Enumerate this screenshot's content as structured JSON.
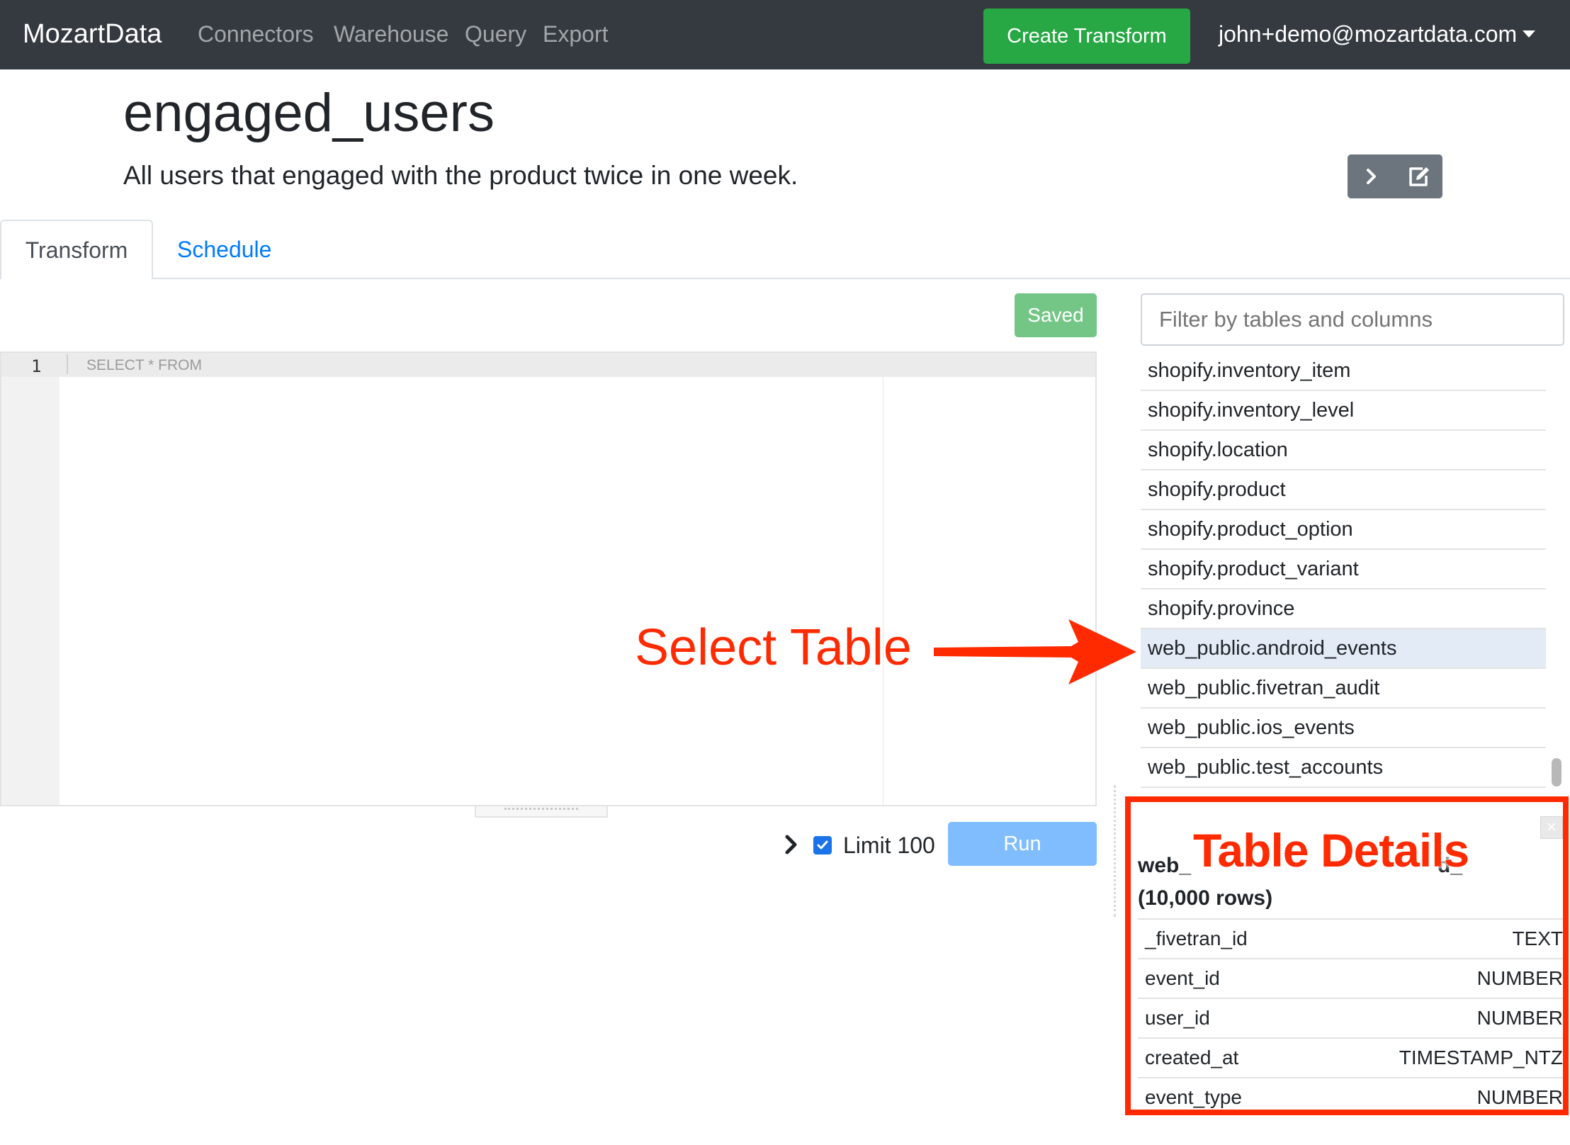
{
  "navbar": {
    "brand": "MozartData",
    "links": [
      "Connectors",
      "Warehouse",
      "Query",
      "Export"
    ],
    "create_button": "Create Transform",
    "user_email": "john+demo@mozartdata.com"
  },
  "header": {
    "title": "engaged_users",
    "description": "All users that engaged with the product twice in one week."
  },
  "tabs": [
    {
      "label": "Transform",
      "active": true
    },
    {
      "label": "Schedule",
      "active": false
    }
  ],
  "editor": {
    "saved_label": "Saved",
    "line_number": "1",
    "placeholder": "SELECT * FROM"
  },
  "run_controls": {
    "limit_label": "Limit 100",
    "limit_checked": true,
    "run_label": "Run"
  },
  "sidebar": {
    "filter_placeholder": "Filter by tables and columns",
    "tables": [
      "shopify.inventory_item",
      "shopify.inventory_level",
      "shopify.location",
      "shopify.product",
      "shopify.product_option",
      "shopify.product_variant",
      "shopify.province",
      "web_public.android_events",
      "web_public.fivetran_audit",
      "web_public.ios_events",
      "web_public.test_accounts"
    ],
    "selected_table": "web_public.android_events"
  },
  "table_details": {
    "name_fragment_left": "web_",
    "name_fragment_right": "d_",
    "row_count": "(10,000 rows)",
    "columns": [
      {
        "name": "_fivetran_id",
        "type": "TEXT"
      },
      {
        "name": "event_id",
        "type": "NUMBER"
      },
      {
        "name": "user_id",
        "type": "NUMBER"
      },
      {
        "name": "created_at",
        "type": "TIMESTAMP_NTZ"
      },
      {
        "name": "event_type",
        "type": "NUMBER"
      }
    ]
  },
  "annotations": {
    "select_table": "Select Table",
    "table_details": "Table Details",
    "color": "#ff2a00"
  },
  "colors": {
    "navbar_bg": "#343a40",
    "create_button": "#28a745",
    "link_blue": "#007bff",
    "run_button": "#80bdff",
    "saved_button": "#74c686",
    "selected_row": "#e2ebf6"
  }
}
